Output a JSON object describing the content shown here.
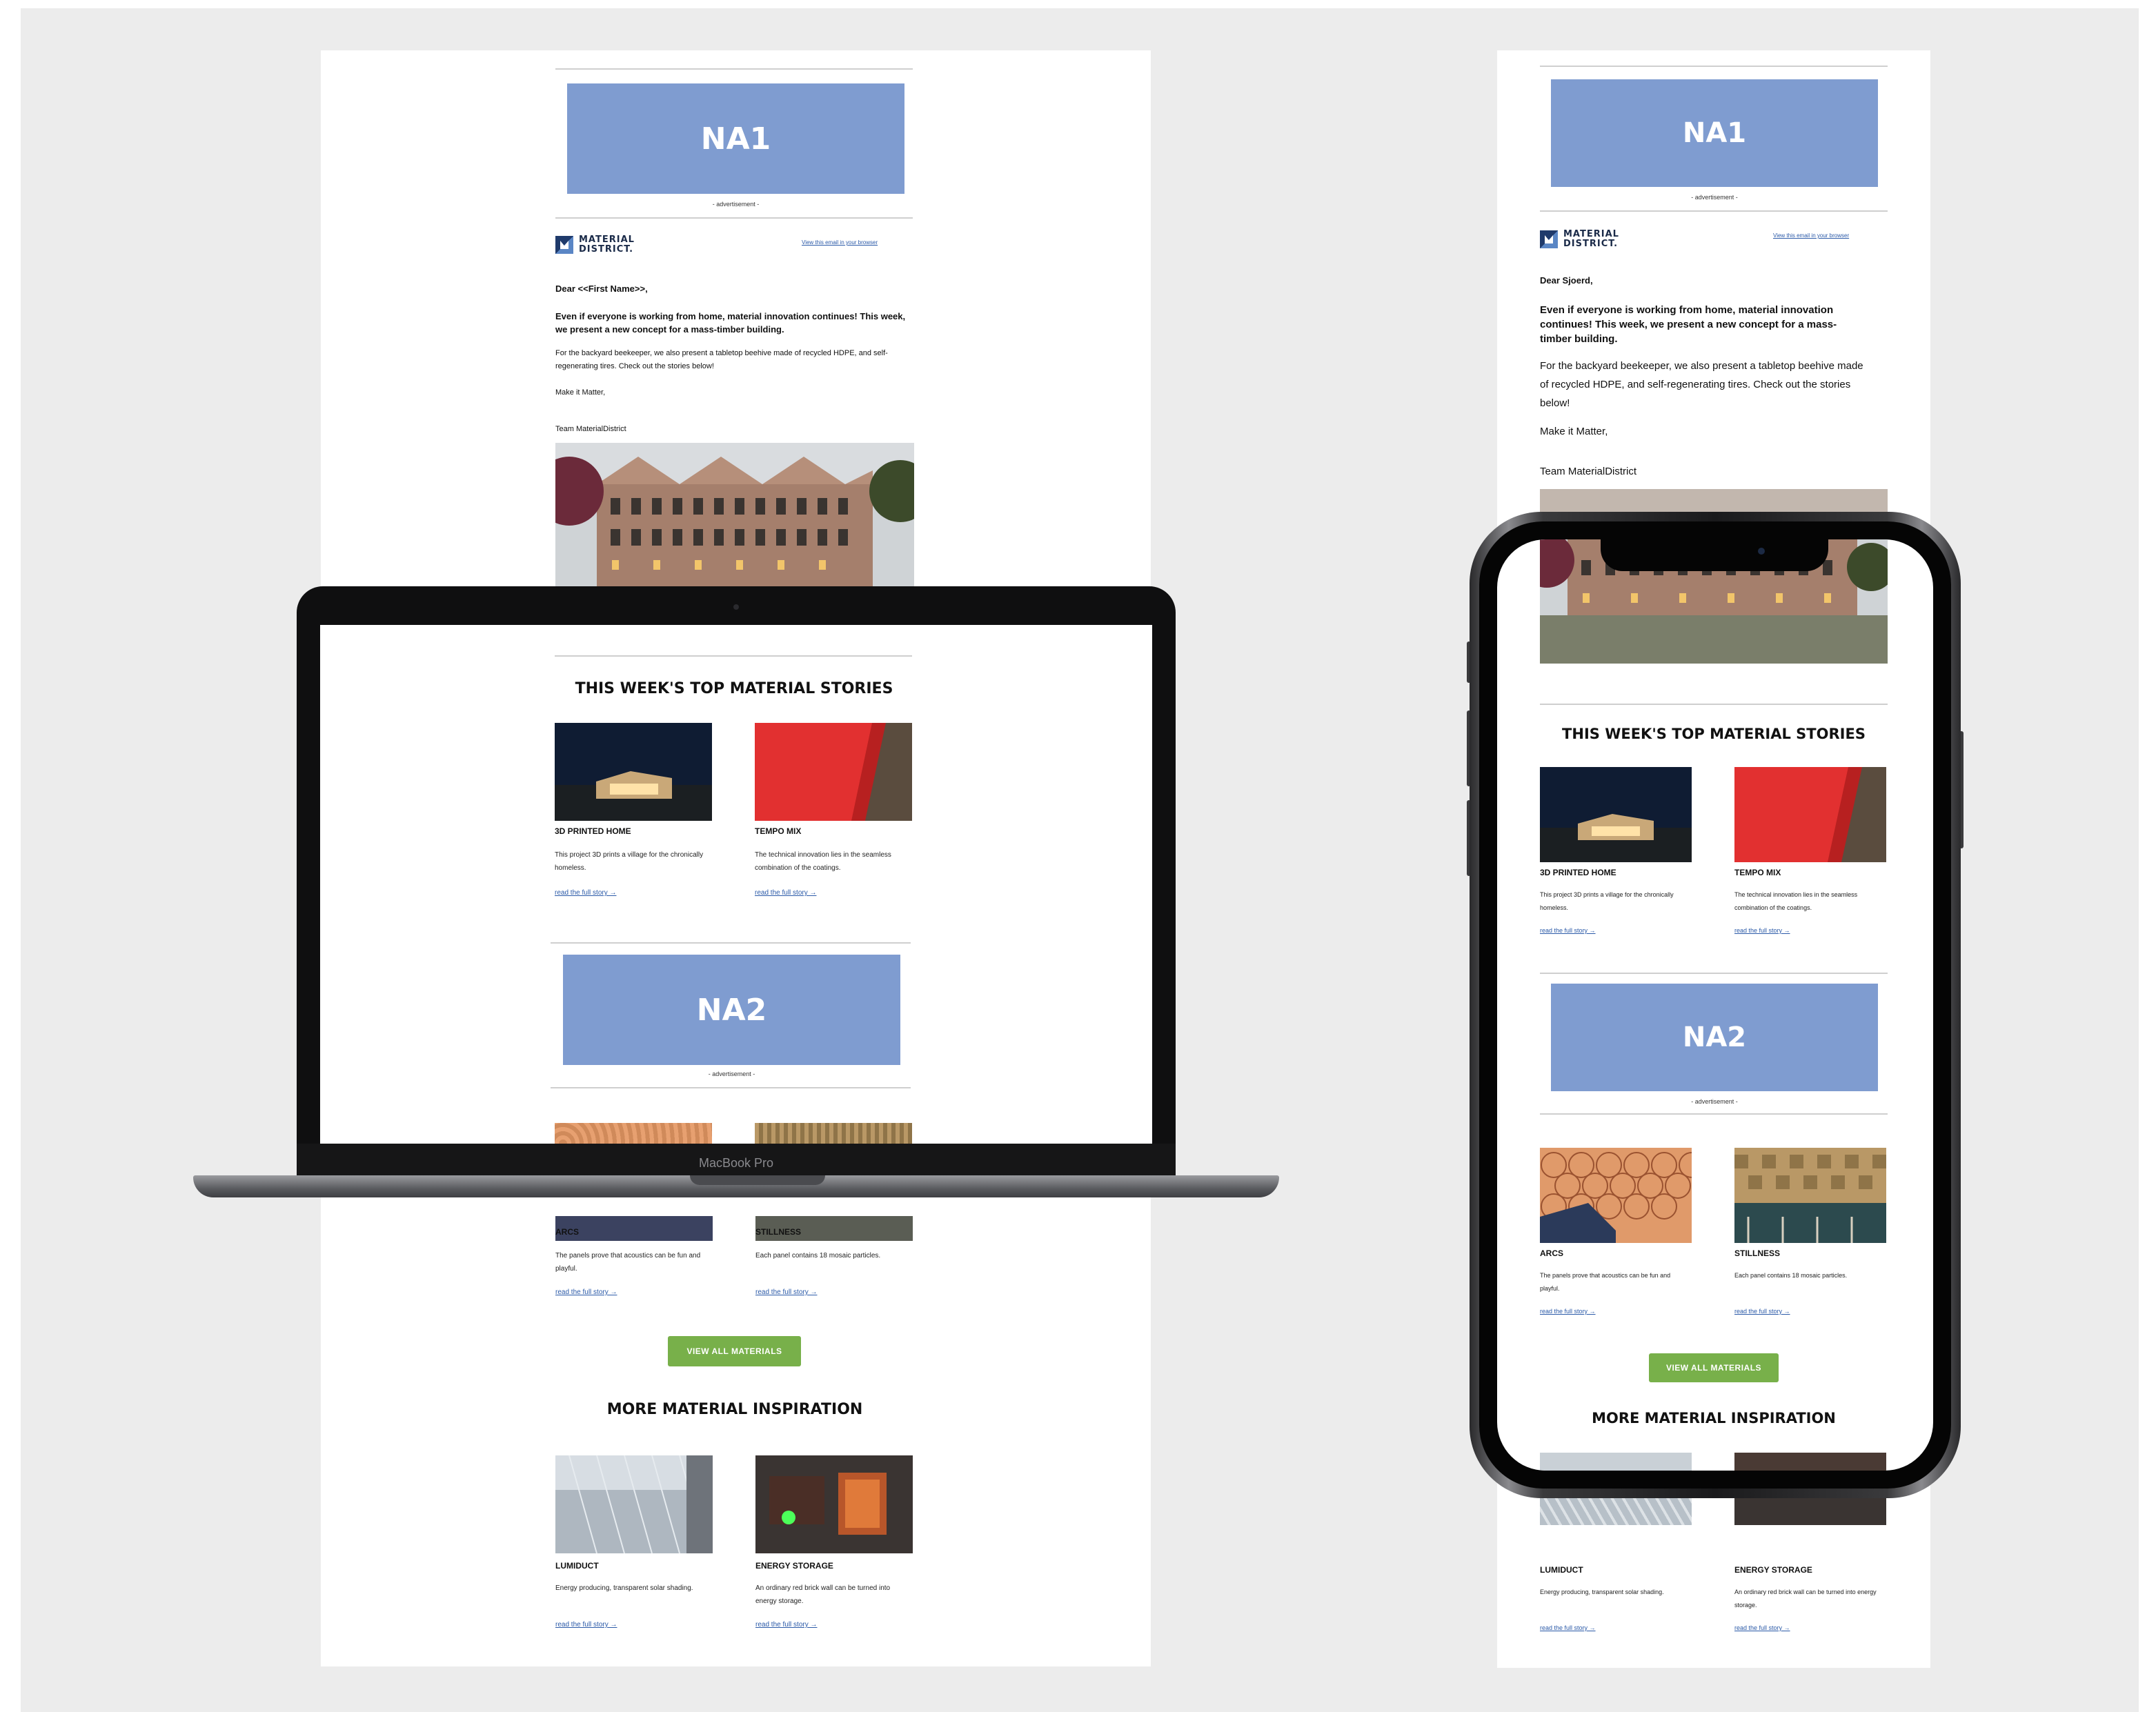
{
  "ads": {
    "na1": "NA1",
    "na2": "NA2",
    "label": "- advertisement -"
  },
  "header": {
    "logo_line1": "MATERIAL",
    "logo_line2": "DISTRICT.",
    "view_link": "View this email in your browser"
  },
  "desktop_intro": {
    "greeting": "Dear <<First Name>>,",
    "lead": "Even if everyone is working from home, material innovation continues! This week, we present a new concept for a mass-timber building.",
    "body": "For the backyard beekeeper, we also present a tabletop beehive made of recycled HDPE, and self-regenerating tires. Check out the stories below!",
    "signoff": "Make it Matter,",
    "team": "Team MaterialDistrict"
  },
  "mobile_intro": {
    "greeting": "Dear Sjoerd,",
    "lead": "Even if everyone is working from home, material innovation continues! This week, we present a new concept for a mass-timber building.",
    "body": "For the backyard beekeeper, we also present a tabletop beehive made of recycled HDPE, and self-regenerating tires. Check out the stories below!",
    "signoff": "Make it Matter,",
    "team": "Team MaterialDistrict"
  },
  "sections": {
    "top_stories": "THIS WEEK'S TOP MATERIAL STORIES",
    "more": "MORE MATERIAL INSPIRATION",
    "button": "VIEW ALL MATERIALS"
  },
  "stories": [
    {
      "title": "3D PRINTED HOME",
      "text": "This project 3D prints a village for the chronically homeless.",
      "link": "read the full story →"
    },
    {
      "title": "TEMPO MIX",
      "text": "The technical innovation lies in the seamless combination of the coatings.",
      "link": "read the full story →"
    },
    {
      "title": "ARCS",
      "text": "The panels prove that acoustics can be fun and playful.",
      "link": "read the full story →"
    },
    {
      "title": "STILLNESS",
      "text": "Each panel contains 18 mosaic particles.",
      "link": "read the full story →"
    },
    {
      "title": "LUMIDUCT",
      "text": "Energy producing, transparent solar shading.",
      "link": "read the full story →"
    },
    {
      "title": "ENERGY STORAGE",
      "text": "An ordinary red brick wall can be turned into energy storage.",
      "link": "read the full story →"
    }
  ],
  "laptop": {
    "label": "MacBook Pro"
  },
  "colors": {
    "ad_banner": "#7f9cd0",
    "button": "#78b04a",
    "link": "#2b5aa8"
  }
}
